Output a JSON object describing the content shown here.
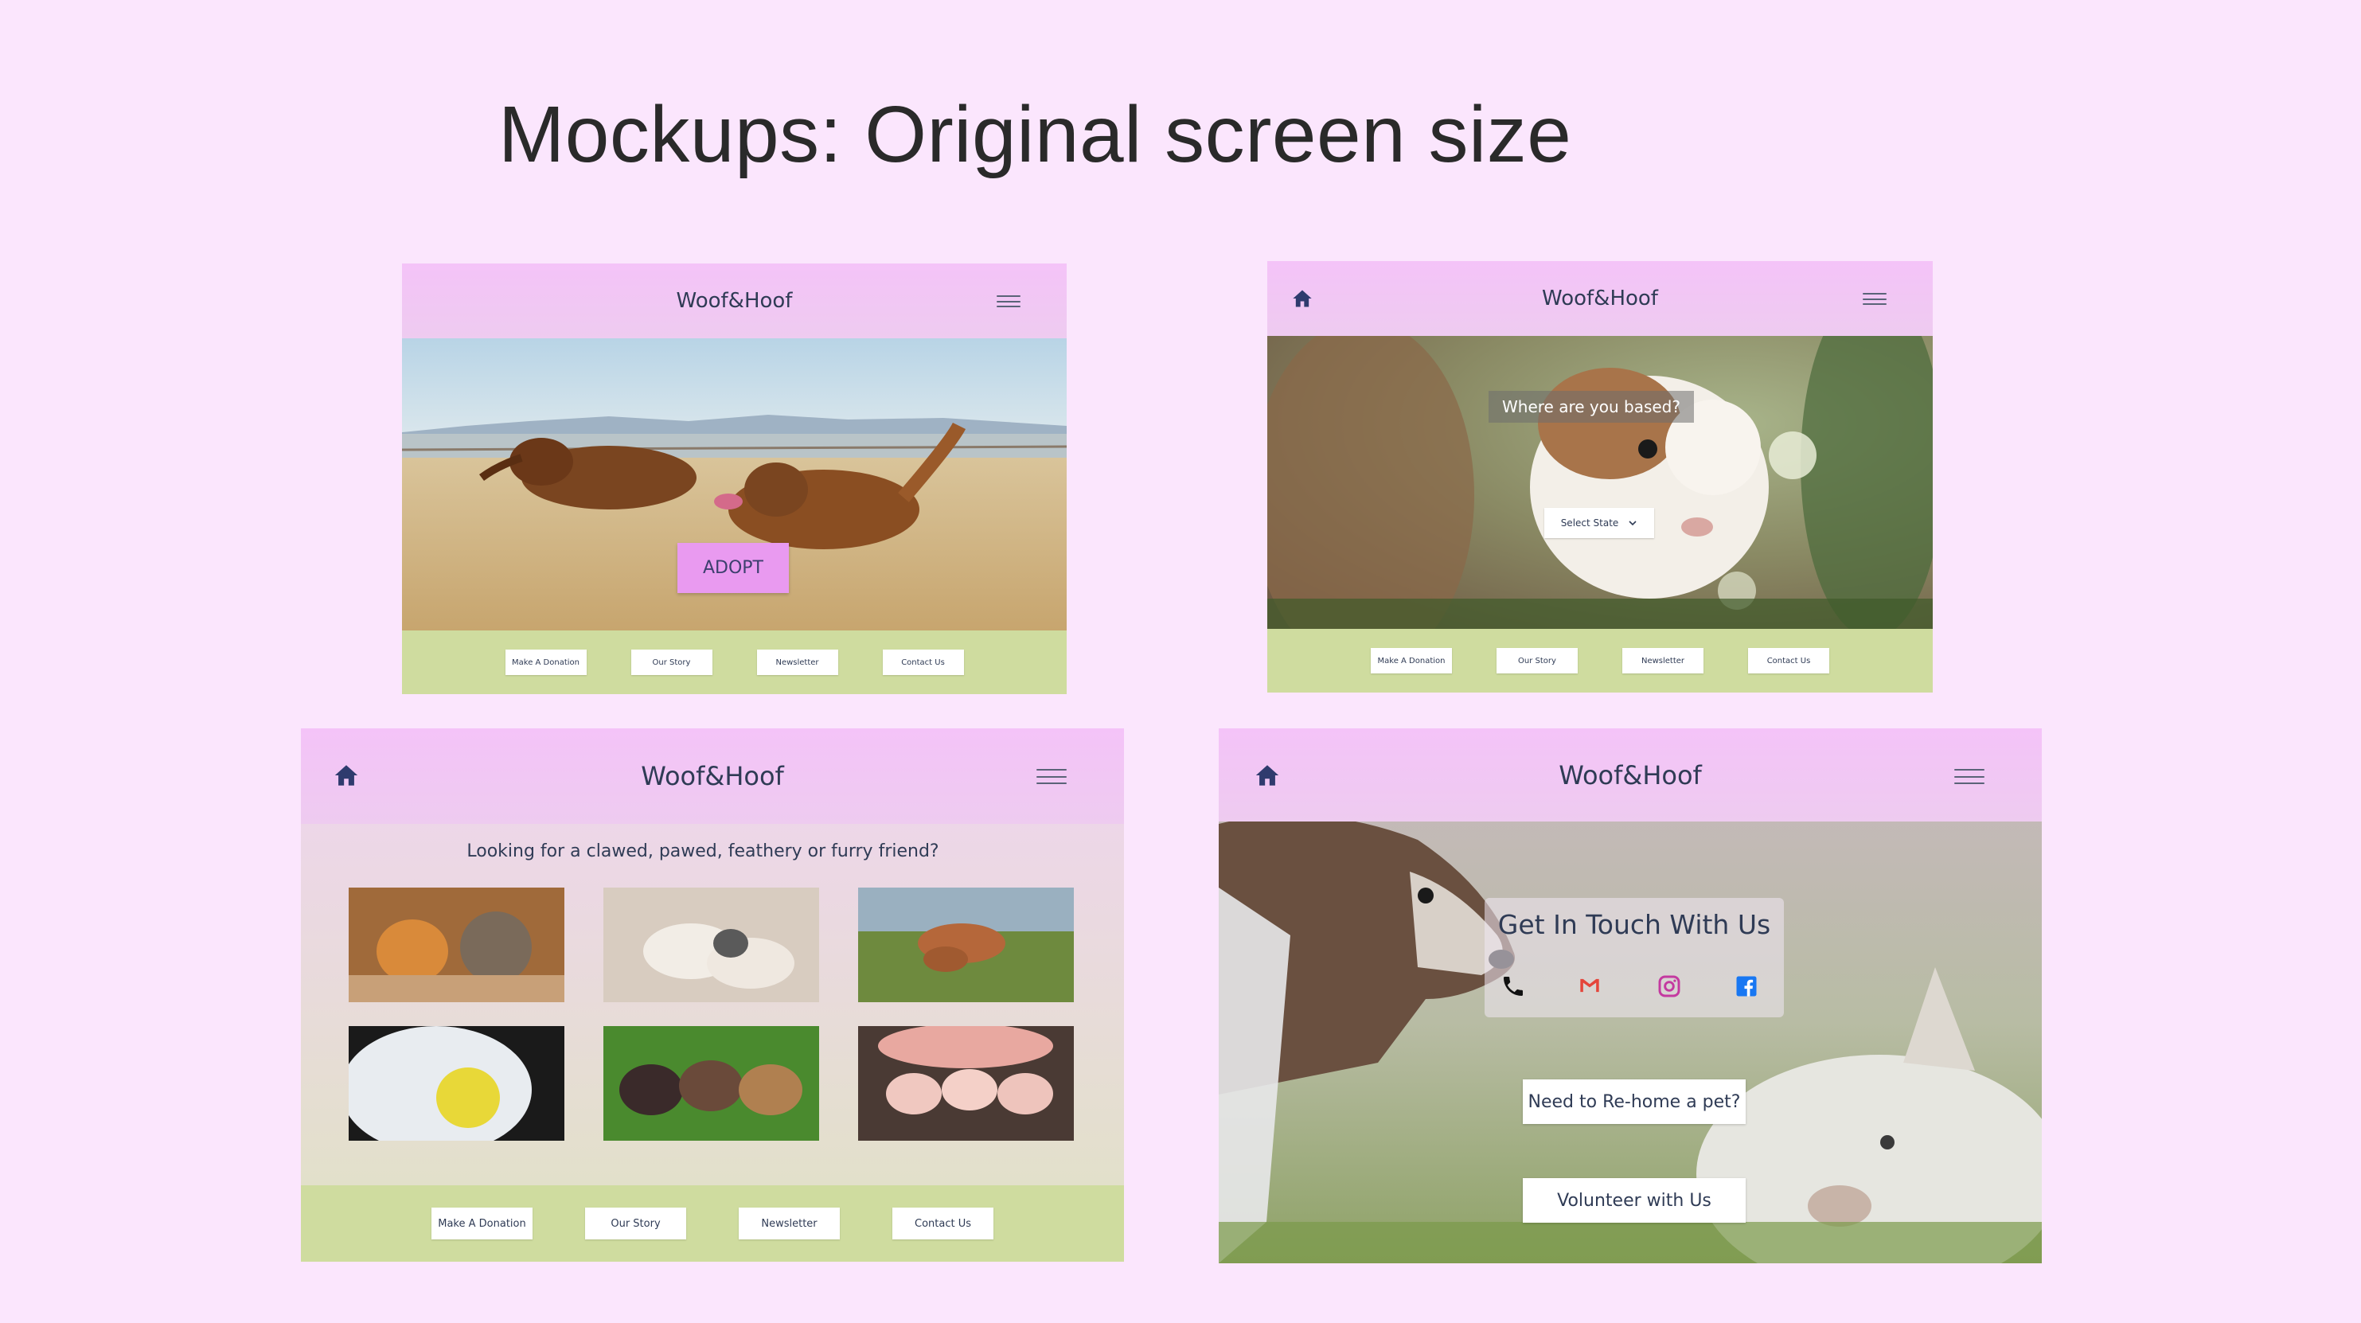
{
  "page": {
    "title": "Mockups: Original screen size"
  },
  "mockups": {
    "adopt": {
      "brand": "Woof&Hoof",
      "cta": "ADOPT",
      "footer": [
        "Make A Donation",
        "Our Story",
        "Newsletter",
        "Contact Us"
      ]
    },
    "location": {
      "brand": "Woof&Hoof",
      "question": "Where are you based?",
      "select_label": "Select State",
      "footer": [
        "Make A Donation",
        "Our Story",
        "Newsletter",
        "Contact Us"
      ]
    },
    "gallery": {
      "brand": "Woof&Hoof",
      "heading": "Looking for a clawed, pawed, feathery or furry friend?",
      "footer": [
        "Make A Donation",
        "Our Story",
        "Newsletter",
        "Contact Us"
      ]
    },
    "contact": {
      "brand": "Woof&Hoof",
      "heading": "Get In Touch With Us",
      "rehome": "Need to Re-home a pet?",
      "volunteer": "Volunteer with Us"
    }
  },
  "icons": [
    "home-icon",
    "hamburger-menu-icon",
    "chevron-down-icon",
    "phone-icon",
    "gmail-icon",
    "instagram-icon",
    "facebook-icon"
  ],
  "colors": {
    "background": "#fbe6fd",
    "header": "#f4c3f8",
    "footer": "#cfdc9f",
    "cta": "#e99af0",
    "text_dark": "#2f3b55"
  }
}
